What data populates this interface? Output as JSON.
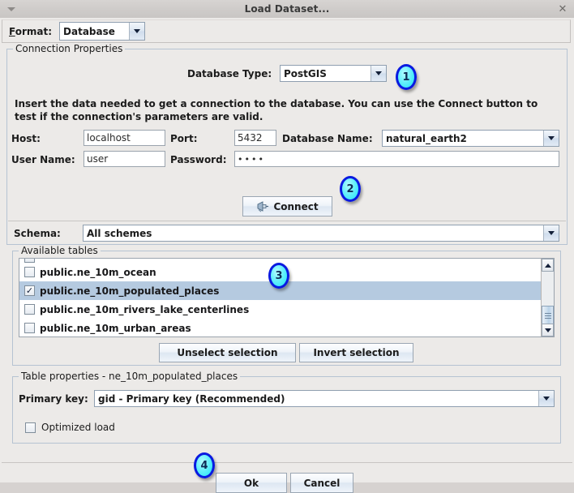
{
  "window": {
    "title": "Load Dataset...",
    "menu_icon": "triangle-down-icon",
    "close_icon": "close-icon"
  },
  "format_bar": {
    "label": "Format:",
    "label_mnemonic": "F",
    "label_rest": "ormat:",
    "value": "Database"
  },
  "connection_properties": {
    "group_title": "Connection Properties",
    "database_type_label": "Database Type:",
    "database_type_value": "PostGIS",
    "description": "Insert the data needed to get a connection to the database. You can use the Connect button to test if the connection's parameters are valid.",
    "host_label": "Host:",
    "host_value": "localhost",
    "port_label": "Port:",
    "port_value": "5432",
    "database_name_label": "Database Name:",
    "database_name_value": "natural_earth2",
    "user_name_label": "User Name:",
    "user_name_value": "user",
    "password_label": "Password:",
    "password_value": "••••",
    "connect_button": "Connect",
    "connect_icon": "plug-connect-icon",
    "schema_label": "Schema:",
    "schema_value": "All schemes"
  },
  "available_tables": {
    "group_title": "Available tables",
    "rows": [
      {
        "label": "",
        "checked": false,
        "selected": false,
        "clipped": true
      },
      {
        "label": "public.ne_10m_ocean",
        "checked": false,
        "selected": false,
        "clipped": false
      },
      {
        "label": "public.ne_10m_populated_places",
        "checked": true,
        "selected": true,
        "clipped": false
      },
      {
        "label": "public.ne_10m_rivers_lake_centerlines",
        "checked": false,
        "selected": false,
        "clipped": false
      },
      {
        "label": "public.ne_10m_urban_areas",
        "checked": false,
        "selected": false,
        "clipped": false
      }
    ],
    "unselect_button": "Unselect selection",
    "invert_button": "Invert selection",
    "scroll_up_icon": "triangle-up-icon",
    "scroll_down_icon": "triangle-down-icon"
  },
  "table_properties": {
    "group_title": "Table properties - ne_10m_populated_places",
    "primary_key_label": "Primary key:",
    "primary_key_value": "gid - Primary key (Recommended)",
    "optimized_load_label": "Optimized load",
    "optimized_load_checked": false
  },
  "footer": {
    "ok_button": "Ok",
    "cancel_button": "Cancel"
  },
  "callouts": [
    {
      "number": "1"
    },
    {
      "number": "2"
    },
    {
      "number": "3"
    },
    {
      "number": "4"
    }
  ],
  "colors": {
    "badge_fill": "#35e6f7",
    "badge_border": "#0a1ae0",
    "selection": "#b5cae0",
    "window_bg": "#eceae8"
  }
}
